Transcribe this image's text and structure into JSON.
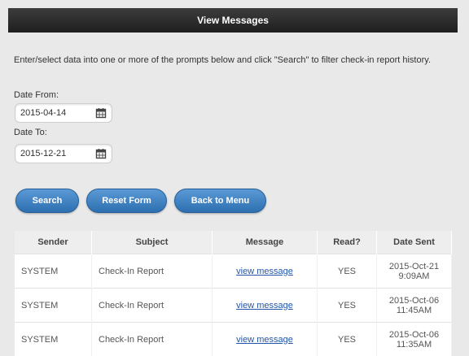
{
  "header": {
    "title": "View Messages"
  },
  "intro": {
    "text": "Enter/select data into one or more of the prompts below and click \"Search\" to filter check-in report history."
  },
  "filters": {
    "date_from_label": "Date From:",
    "date_from_value": "2015-04-14",
    "date_to_label": "Date To:",
    "date_to_value": "2015-12-21"
  },
  "buttons": {
    "search": "Search",
    "reset": "Reset Form",
    "back": "Back to Menu"
  },
  "table": {
    "headers": [
      "Sender",
      "Subject",
      "Message",
      "Read?",
      "Date Sent"
    ],
    "rows": [
      {
        "sender": "SYSTEM",
        "subject": "Check-In Report",
        "message": "view message",
        "read": "YES",
        "date": "2015-Oct-21",
        "time": "9:09AM"
      },
      {
        "sender": "SYSTEM",
        "subject": "Check-In Report",
        "message": "view message",
        "read": "YES",
        "date": "2015-Oct-06",
        "time": "11:45AM"
      },
      {
        "sender": "SYSTEM",
        "subject": "Check-In Report",
        "message": "view message",
        "read": "YES",
        "date": "2015-Oct-06",
        "time": "11:35AM"
      }
    ]
  },
  "colors": {
    "button": "#2d6fb0",
    "header": "#2a2a2a",
    "link": "#2255aa"
  }
}
